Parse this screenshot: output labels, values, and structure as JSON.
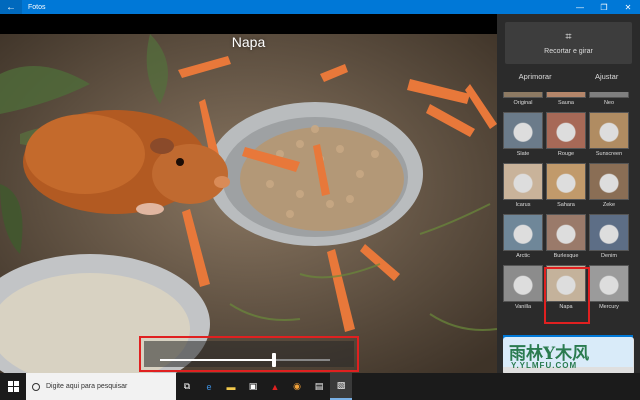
{
  "window": {
    "title": "Fotos",
    "back_glyph": "←",
    "minimize_glyph": "—",
    "maximize_glyph": "❐",
    "close_glyph": "✕"
  },
  "photo": {
    "filter_name": "Napa",
    "intensity_percent": 67
  },
  "panel": {
    "crop_label": "Recortar e girar",
    "crop_icon": "crop-icon",
    "tabs": [
      "Aprimorar",
      "Ajustar"
    ],
    "filters": [
      {
        "name": "Original",
        "tint": "#8d7a63"
      },
      {
        "name": "Sauna",
        "tint": "#b5866a"
      },
      {
        "name": "Neo",
        "tint": "#7f7f7f"
      },
      {
        "name": "Slate",
        "tint": "#6b7b8a"
      },
      {
        "name": "Rouge",
        "tint": "#a76957"
      },
      {
        "name": "Sunscreen",
        "tint": "#b08c62"
      },
      {
        "name": "Icarus",
        "tint": "#c9b39a"
      },
      {
        "name": "Sahara",
        "tint": "#c19a6b"
      },
      {
        "name": "Zeke",
        "tint": "#8a6e55"
      },
      {
        "name": "Arctic",
        "tint": "#6f8799"
      },
      {
        "name": "Burlesque",
        "tint": "#9a7a6a"
      },
      {
        "name": "Denim",
        "tint": "#5d6e86"
      },
      {
        "name": "Vanilla",
        "tint": "#8c8c8c"
      },
      {
        "name": "Napa",
        "tint": "#c4b29b"
      },
      {
        "name": "Mercury",
        "tint": "#9b9b9b"
      }
    ],
    "selected_filter": "Napa"
  },
  "watermark": {
    "main": "雨林",
    "main_tail": "木风",
    "sub": "Y.YLMFU.COM"
  },
  "taskbar": {
    "search_placeholder": "Digite aqui para pesquisar",
    "icons": [
      "task-view-icon",
      "edge-icon",
      "file-explorer-icon",
      "store-icon",
      "acrobat-icon",
      "chrome-icon",
      "sticky-icon",
      "photos-icon"
    ]
  },
  "colors": {
    "accent": "#0078d7",
    "highlight_red": "#e02020"
  }
}
